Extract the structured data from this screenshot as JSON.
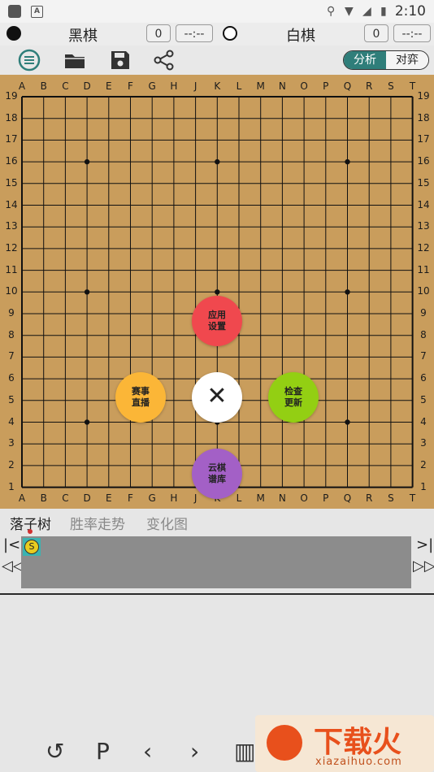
{
  "statusbar": {
    "time": "2:10"
  },
  "players": {
    "black_label": "黑棋",
    "black_captures": "0",
    "black_time": "--:--",
    "white_label": "白棋",
    "white_captures": "0",
    "white_time": "--:--"
  },
  "toolbar": {
    "icons": [
      "menu-icon",
      "folder-icon",
      "save-icon",
      "share-icon"
    ],
    "mode_analysis": "分析",
    "mode_battle": "对弈"
  },
  "board": {
    "size": 19,
    "columns": [
      "A",
      "B",
      "C",
      "D",
      "E",
      "F",
      "G",
      "H",
      "J",
      "K",
      "L",
      "M",
      "N",
      "O",
      "P",
      "Q",
      "R",
      "S",
      "T"
    ],
    "rows": [
      "19",
      "18",
      "17",
      "16",
      "15",
      "14",
      "13",
      "12",
      "11",
      "10",
      "9",
      "8",
      "7",
      "6",
      "5",
      "4",
      "3",
      "2",
      "1"
    ],
    "star_points": [
      "D16",
      "K16",
      "Q16",
      "D10",
      "K10",
      "Q10",
      "D4",
      "K4",
      "Q4"
    ]
  },
  "menu": {
    "settings": [
      "应用",
      "设置"
    ],
    "live": [
      "赛事",
      "直播"
    ],
    "check_update": [
      "检查",
      "更新"
    ],
    "cloud": [
      "云棋",
      "谱库"
    ],
    "close": "✕"
  },
  "tabs": {
    "tree": "落子树",
    "winrate": "胜率走势",
    "variation": "变化图"
  },
  "tree": {
    "start_node": "S"
  },
  "bottom": {
    "icons": [
      "undo-icon",
      "pass-icon",
      "prev-icon",
      "next-icon",
      "chart-icon"
    ],
    "pass_label": "P"
  },
  "watermark": {
    "brand": "下载火",
    "url": "xiazaihuo.com"
  },
  "colors": {
    "board": "#c99d5c",
    "accent": "#2f7e7a",
    "settings": "#f0484e",
    "live": "#fbb637",
    "update": "#93cf13",
    "cloud": "#a360c6"
  }
}
